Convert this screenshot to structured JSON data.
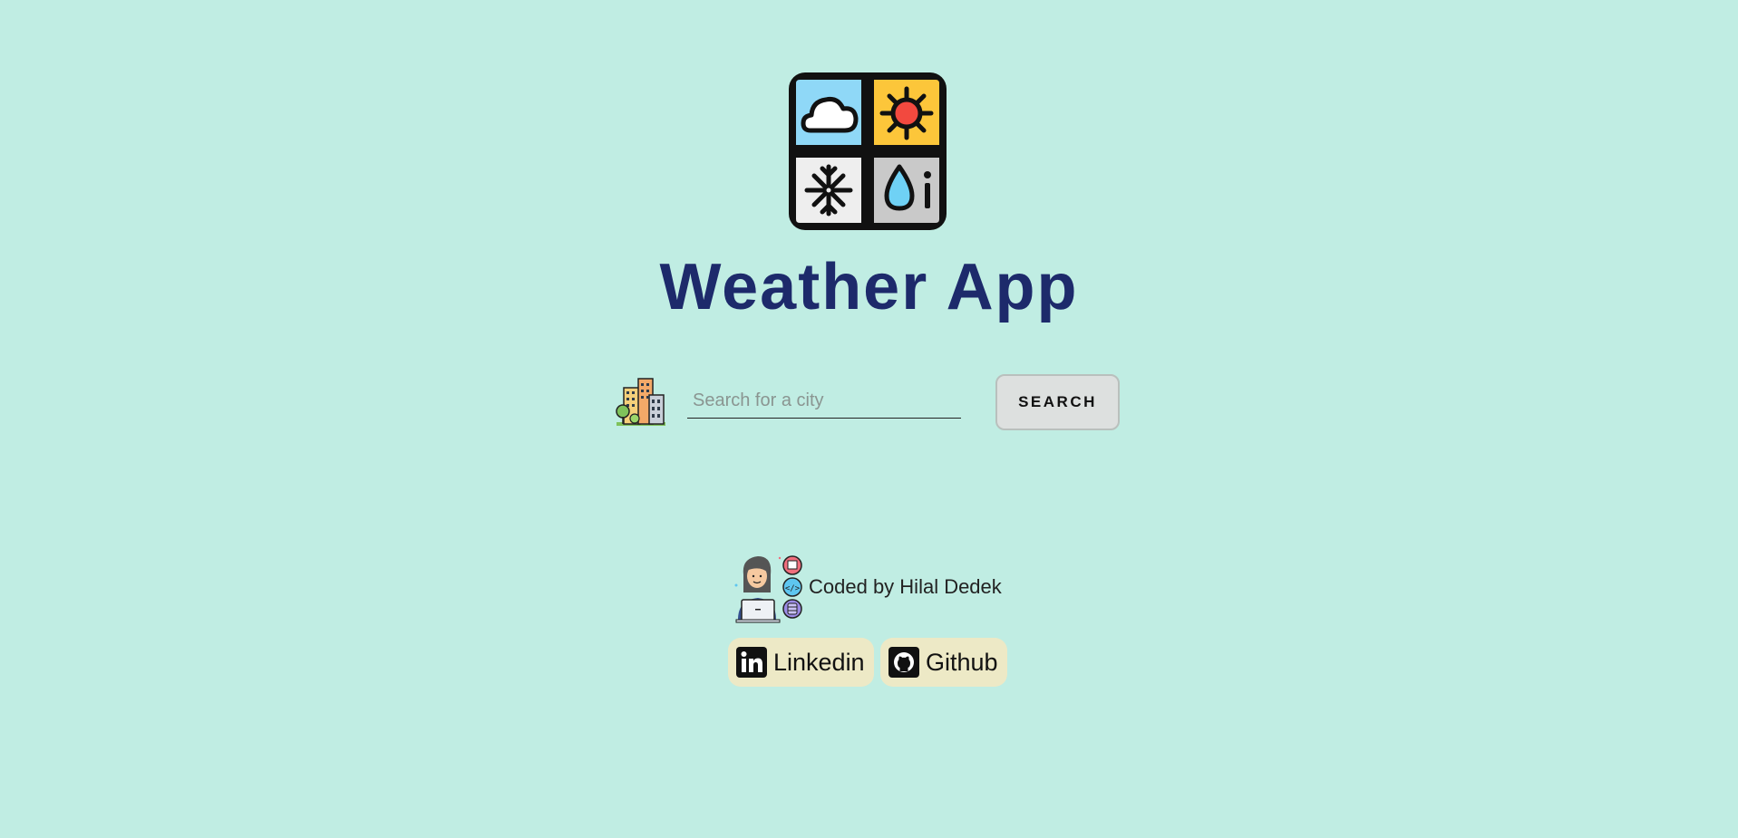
{
  "app": {
    "title": "Weather App"
  },
  "search": {
    "placeholder": "Search for a city",
    "value": "",
    "button_label": "SEARCH"
  },
  "footer": {
    "credit": "Coded by Hilal Dedek",
    "links": [
      {
        "label": "Linkedin",
        "icon": "linkedin-icon"
      },
      {
        "label": "Github",
        "icon": "github-icon"
      }
    ]
  },
  "icons": {
    "logo": "weather-logo-icon",
    "city": "city-buildings-icon",
    "developer": "developer-avatar-icon"
  },
  "colors": {
    "background": "#c0ede3",
    "title": "#1d2a6b",
    "link_bg": "#ede9c6",
    "button_bg": "#dde0df"
  }
}
